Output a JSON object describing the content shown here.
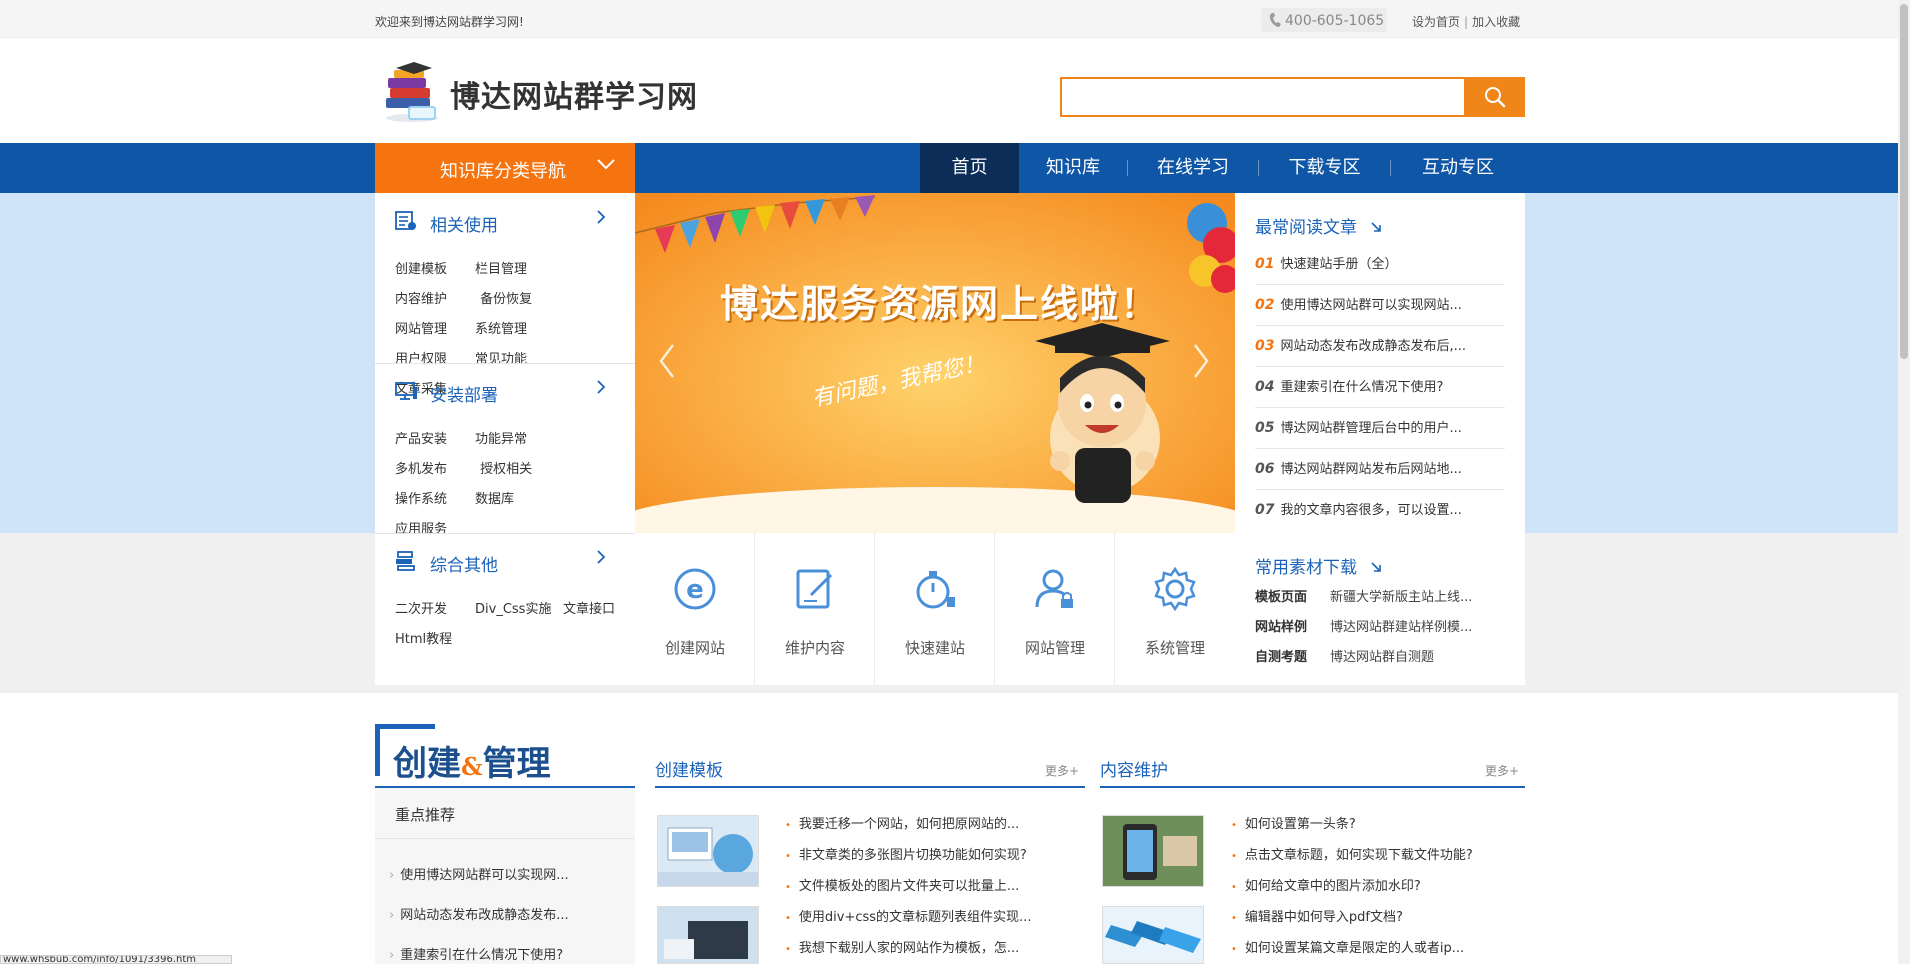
{
  "topbar": {
    "welcome": "欢迎来到博达网站群学习网!",
    "phone": "400-605-1065",
    "set_home": "设为首页",
    "separator": "|",
    "add_favorite": "加入收藏"
  },
  "header": {
    "logo_text": "博达网站群学习网",
    "search_placeholder": ""
  },
  "nav": {
    "category_label": "知识库分类导航",
    "items": [
      {
        "label": "首页",
        "active": true
      },
      {
        "label": "知识库",
        "active": false
      },
      {
        "label": "在线学习",
        "active": false
      },
      {
        "label": "下载专区",
        "active": false
      },
      {
        "label": "互动专区",
        "active": false
      }
    ]
  },
  "categories": [
    {
      "title": "相关使用",
      "icon": "document-list-icon",
      "links": [
        "创建模板",
        "栏目管理",
        "内容维护",
        "备份恢复",
        "网站管理",
        "系统管理",
        "用户权限",
        "常见功能",
        "文章采集"
      ]
    },
    {
      "title": "安装部署",
      "icon": "monitor-icon",
      "links": [
        "产品安装",
        "功能异常",
        "多机发布",
        "授权相关",
        "操作系统",
        "数据库",
        "应用服务"
      ]
    },
    {
      "title": "综合其他",
      "icon": "database-stack-icon",
      "links": [
        "二次开发",
        "Div_Css实施",
        "文章接口",
        "Html教程"
      ]
    }
  ],
  "banner": {
    "title": "博达服务资源网上线啦！",
    "subtitle": "有问题，我帮您！"
  },
  "most_read": {
    "title": "最常阅读文章",
    "items": [
      {
        "num": "01",
        "text": "快速建站手册（全）",
        "hot": true
      },
      {
        "num": "02",
        "text": "使用博达网站群可以实现网站...",
        "hot": true
      },
      {
        "num": "03",
        "text": "网站动态发布改成静态发布后,...",
        "hot": true
      },
      {
        "num": "04",
        "text": "重建索引在什么情况下使用?",
        "hot": false
      },
      {
        "num": "05",
        "text": "博达网站群管理后台中的用户...",
        "hot": false
      },
      {
        "num": "06",
        "text": "博达网站群网站发布后网站地...",
        "hot": false
      },
      {
        "num": "07",
        "text": "我的文章内容很多，可以设置...",
        "hot": false
      }
    ]
  },
  "quick_links": [
    {
      "label": "创建网站",
      "icon": "ie-browser-icon"
    },
    {
      "label": "维护内容",
      "icon": "edit-document-icon"
    },
    {
      "label": "快速建站",
      "icon": "stopwatch-icon"
    },
    {
      "label": "网站管理",
      "icon": "user-lock-icon"
    },
    {
      "label": "系统管理",
      "icon": "gear-icon"
    }
  ],
  "materials": {
    "title": "常用素材下载",
    "rows": [
      {
        "key": "模板页面",
        "value": "新疆大学新版主站上线..."
      },
      {
        "key": "网站样例",
        "value": "博达网站群建站样例模..."
      },
      {
        "key": "自测考题",
        "value": "博达网站群自测题"
      }
    ]
  },
  "section": {
    "title_a": "创建",
    "title_amp": "&",
    "title_b": "管理",
    "recommend_title": "重点推荐",
    "recommend_items": [
      "使用博达网站群可以实现网...",
      "网站动态发布改成静态发布...",
      "重建索引在什么情况下使用?"
    ]
  },
  "columns": [
    {
      "title": "创建模板",
      "more": "更多+",
      "items": [
        "我要迁移一个网站，如何把原网站的...",
        "非文章类的多张图片切换功能如何实现?",
        "文件模板处的图片文件夹可以批量上...",
        "使用div+css的文章标题列表组件实现...",
        "我想下载别人家的网站作为模板，怎..."
      ]
    },
    {
      "title": "内容维护",
      "more": "更多+",
      "items": [
        "如何设置第一头条?",
        "点击文章标题，如何实现下载文件功能?",
        "如何给文章中的图片添加水印?",
        "编辑器中如何导入pdf文档?",
        "如何设置某篇文章是限定的人或者ip..."
      ]
    }
  ],
  "status_url": "www.whsbub.com/info/1091/3396.htm",
  "colors": {
    "brand_blue": "#0f57a6",
    "accent_orange": "#f5740f",
    "nav_active": "#0c2d57",
    "band_blue": "#cfe4f8"
  }
}
